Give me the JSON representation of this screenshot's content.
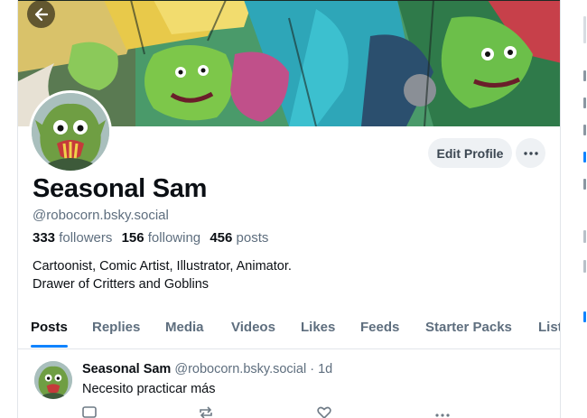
{
  "banner": {
    "art": "goblin-comic-illustration"
  },
  "profile": {
    "display_name": "Seasonal Sam",
    "handle": "@robocorn.bsky.social",
    "followers_count": "333",
    "followers_label": "followers",
    "following_count": "156",
    "following_label": "following",
    "posts_count": "456",
    "posts_label": "posts",
    "bio_line1": "Cartoonist, Comic Artist, Illustrator, Animator.",
    "bio_line2": "Drawer of Critters and Goblins"
  },
  "actions": {
    "edit_profile_label": "Edit Profile"
  },
  "tabs": [
    {
      "label": "Posts",
      "active": true
    },
    {
      "label": "Replies"
    },
    {
      "label": "Media"
    },
    {
      "label": "Videos"
    },
    {
      "label": "Likes"
    },
    {
      "label": "Feeds"
    },
    {
      "label": "Starter Packs"
    },
    {
      "label": "List"
    }
  ],
  "post": {
    "author": "Seasonal Sam",
    "handle": "@robocorn.bsky.social",
    "separator": "·",
    "time": "1d",
    "text": "Necesito practicar más",
    "actions": [
      "reply-icon",
      "repost-icon",
      "like-icon",
      "more-icon"
    ]
  },
  "colors": {
    "accent": "#1083fe",
    "text": "#0b0f14",
    "muted": "#5e6e7e",
    "button_bg": "#eef1f4",
    "border": "#e2e6ea"
  }
}
